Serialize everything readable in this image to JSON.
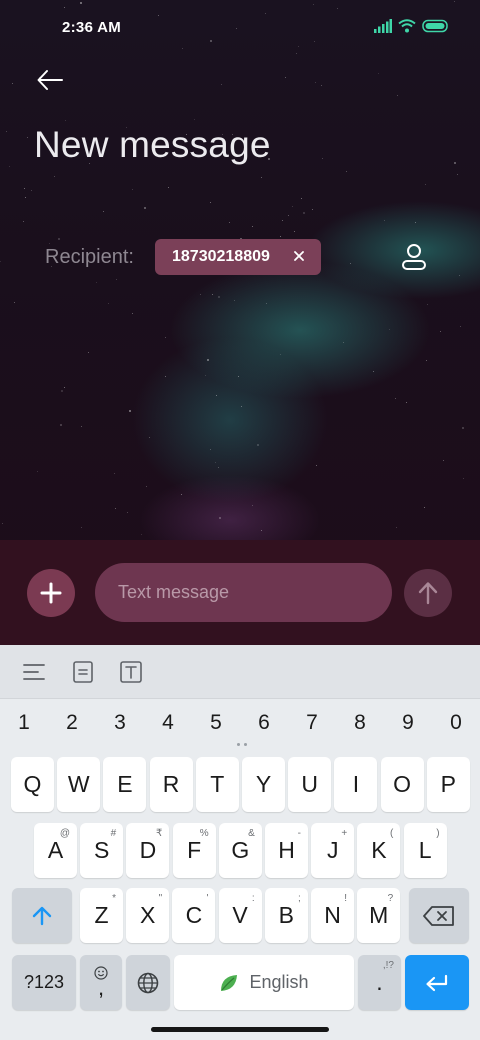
{
  "status_bar": {
    "time": "2:36 AM",
    "icons": [
      "signal-icon",
      "wifi-icon",
      "battery-icon"
    ]
  },
  "header": {
    "back_icon": "arrow-left-icon",
    "title": "New message"
  },
  "recipient": {
    "label": "Recipient:",
    "chip_value": "18730218809",
    "chip_remove_icon": "close-icon",
    "contacts_icon": "person-icon"
  },
  "compose": {
    "attach_icon": "plus-icon",
    "placeholder": "Text message",
    "send_icon": "arrow-up-icon"
  },
  "keyboard": {
    "toolbar_icons": [
      "menu-lines-icon",
      "clipboard-icon",
      "text-style-icon"
    ],
    "number_row": [
      "1",
      "2",
      "3",
      "4",
      "5",
      "6",
      "7",
      "8",
      "9",
      "0"
    ],
    "row1": [
      "Q",
      "W",
      "E",
      "R",
      "T",
      "Y",
      "U",
      "I",
      "O",
      "P"
    ],
    "row2": [
      {
        "key": "A",
        "hint": "@"
      },
      {
        "key": "S",
        "hint": "#"
      },
      {
        "key": "D",
        "hint": "₹"
      },
      {
        "key": "F",
        "hint": "%"
      },
      {
        "key": "G",
        "hint": "&"
      },
      {
        "key": "H",
        "hint": "-"
      },
      {
        "key": "J",
        "hint": "+"
      },
      {
        "key": "K",
        "hint": "("
      },
      {
        "key": "L",
        "hint": ")"
      }
    ],
    "row3": [
      {
        "key": "Z",
        "hint": "*"
      },
      {
        "key": "X",
        "hint": "\""
      },
      {
        "key": "C",
        "hint": "'"
      },
      {
        "key": "V",
        "hint": ":"
      },
      {
        "key": "B",
        "hint": ";"
      },
      {
        "key": "N",
        "hint": "!"
      },
      {
        "key": "M",
        "hint": "?"
      }
    ],
    "symbols_label": "?123",
    "comma": ",",
    "space_label": "English",
    "period": ".",
    "period_hint": ",!?",
    "enter_icon": "enter-icon",
    "accent_color": "#1a96f5"
  },
  "colors": {
    "chip": "#7b4058",
    "compose_bg": "#32111f",
    "input_bg": "#6e3650"
  }
}
